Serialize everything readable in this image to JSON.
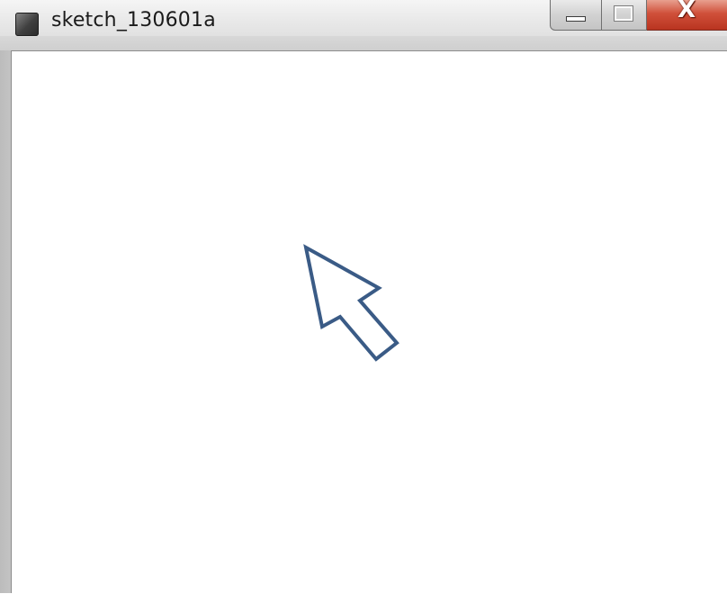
{
  "window": {
    "title": "sketch_130601a"
  },
  "controls": {
    "minimize": "minimize-icon",
    "maximize": "maximize-icon",
    "close": "close-icon",
    "close_glyph": "X"
  },
  "canvas": {
    "background": "#ffffff",
    "cursor": {
      "icon": "arrow-cursor-icon",
      "stroke": "#3a5b86",
      "fill": "#ffffff"
    }
  }
}
